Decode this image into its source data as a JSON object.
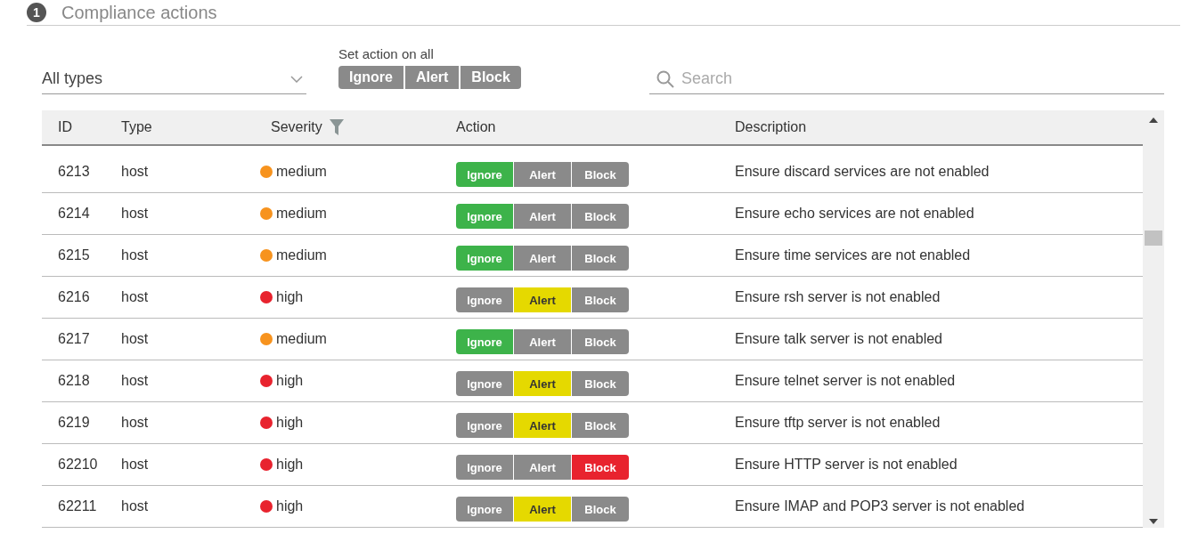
{
  "section": {
    "number": "1",
    "title": "Compliance actions"
  },
  "type_filter": {
    "value": "All types"
  },
  "set_action_on_all": {
    "label": "Set action on all",
    "buttons": [
      {
        "label": "Ignore"
      },
      {
        "label": "Alert"
      },
      {
        "label": "Block"
      }
    ]
  },
  "search": {
    "placeholder": "Search"
  },
  "table": {
    "columns": [
      {
        "label": "ID"
      },
      {
        "label": "Type"
      },
      {
        "label": "Severity",
        "filter": true
      },
      {
        "label": "Action"
      },
      {
        "label": "Description"
      }
    ],
    "rows": [
      {
        "id": "6213",
        "type": "host",
        "severity": {
          "label": "medium",
          "color": "#f7931e"
        },
        "actions": [
          {
            "kind": "ignore",
            "label": "Ignore",
            "selected": true
          },
          {
            "kind": "alert",
            "label": "Alert",
            "selected": false
          },
          {
            "kind": "block",
            "label": "Block",
            "selected": false
          }
        ],
        "description": "Ensure discard services are not enabled"
      },
      {
        "id": "6214",
        "type": "host",
        "severity": {
          "label": "medium",
          "color": "#f7931e"
        },
        "actions": [
          {
            "kind": "ignore",
            "label": "Ignore",
            "selected": true
          },
          {
            "kind": "alert",
            "label": "Alert",
            "selected": false
          },
          {
            "kind": "block",
            "label": "Block",
            "selected": false
          }
        ],
        "description": "Ensure echo services are not enabled"
      },
      {
        "id": "6215",
        "type": "host",
        "severity": {
          "label": "medium",
          "color": "#f7931e"
        },
        "actions": [
          {
            "kind": "ignore",
            "label": "Ignore",
            "selected": true
          },
          {
            "kind": "alert",
            "label": "Alert",
            "selected": false
          },
          {
            "kind": "block",
            "label": "Block",
            "selected": false
          }
        ],
        "description": "Ensure time services are not enabled"
      },
      {
        "id": "6216",
        "type": "host",
        "severity": {
          "label": "high",
          "color": "#e8232e"
        },
        "actions": [
          {
            "kind": "ignore",
            "label": "Ignore",
            "selected": false
          },
          {
            "kind": "alert",
            "label": "Alert",
            "selected": true
          },
          {
            "kind": "block",
            "label": "Block",
            "selected": false
          }
        ],
        "description": "Ensure rsh server is not enabled"
      },
      {
        "id": "6217",
        "type": "host",
        "severity": {
          "label": "medium",
          "color": "#f7931e"
        },
        "actions": [
          {
            "kind": "ignore",
            "label": "Ignore",
            "selected": true
          },
          {
            "kind": "alert",
            "label": "Alert",
            "selected": false
          },
          {
            "kind": "block",
            "label": "Block",
            "selected": false
          }
        ],
        "description": "Ensure talk server is not enabled"
      },
      {
        "id": "6218",
        "type": "host",
        "severity": {
          "label": "high",
          "color": "#e8232e"
        },
        "actions": [
          {
            "kind": "ignore",
            "label": "Ignore",
            "selected": false
          },
          {
            "kind": "alert",
            "label": "Alert",
            "selected": true
          },
          {
            "kind": "block",
            "label": "Block",
            "selected": false
          }
        ],
        "description": "Ensure telnet server is not enabled"
      },
      {
        "id": "6219",
        "type": "host",
        "severity": {
          "label": "high",
          "color": "#e8232e"
        },
        "actions": [
          {
            "kind": "ignore",
            "label": "Ignore",
            "selected": false
          },
          {
            "kind": "alert",
            "label": "Alert",
            "selected": true
          },
          {
            "kind": "block",
            "label": "Block",
            "selected": false
          }
        ],
        "description": "Ensure tftp server is not enabled"
      },
      {
        "id": "62210",
        "type": "host",
        "severity": {
          "label": "high",
          "color": "#e8232e"
        },
        "actions": [
          {
            "kind": "ignore",
            "label": "Ignore",
            "selected": false
          },
          {
            "kind": "alert",
            "label": "Alert",
            "selected": false
          },
          {
            "kind": "block",
            "label": "Block",
            "selected": true
          }
        ],
        "description": "Ensure HTTP server is not enabled"
      },
      {
        "id": "62211",
        "type": "host",
        "severity": {
          "label": "high",
          "color": "#e8232e"
        },
        "actions": [
          {
            "kind": "ignore",
            "label": "Ignore",
            "selected": false
          },
          {
            "kind": "alert",
            "label": "Alert",
            "selected": true
          },
          {
            "kind": "block",
            "label": "Block",
            "selected": false
          }
        ],
        "description": "Ensure IMAP and POP3 server is not enabled"
      }
    ]
  }
}
